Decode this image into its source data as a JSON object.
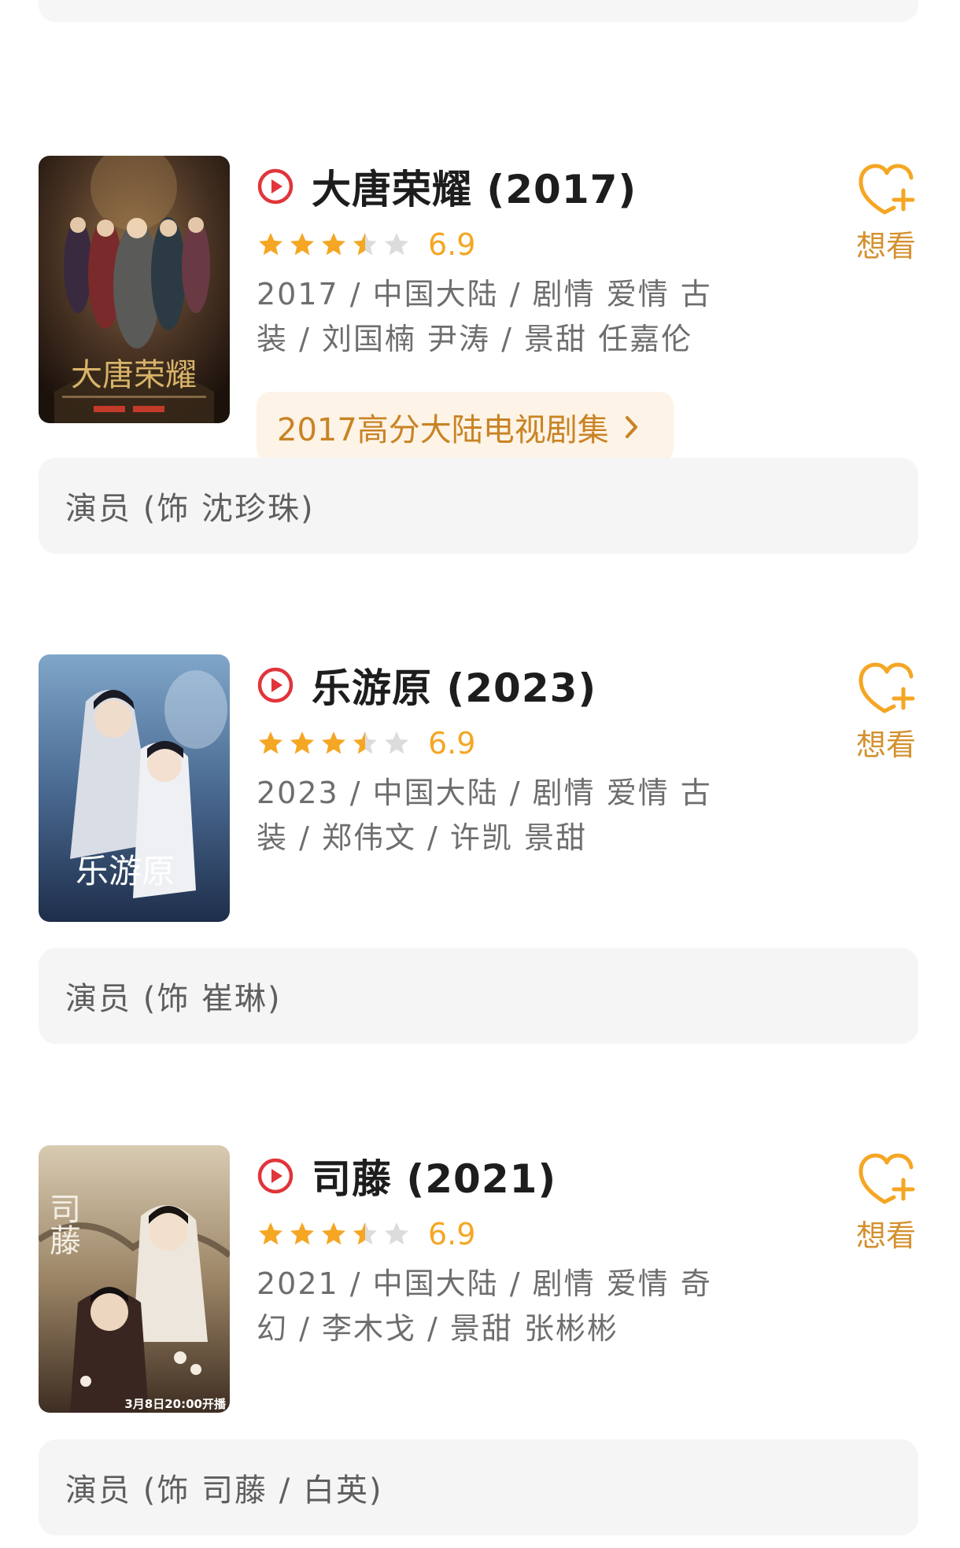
{
  "movies": [
    {
      "title": "大唐荣耀 (2017)",
      "score": "6.9",
      "stars": 3.5,
      "meta_line1": "2017 / 中国大陆 / 剧情 爱情 古",
      "meta_line2": "装 / 刘国楠 尹涛 / 景甜 任嘉伦",
      "collection": "2017高分大陆电视剧集",
      "want_label": "想看",
      "role": "演员 (饰 沈珍珠)",
      "poster_text": "大唐荣耀"
    },
    {
      "title": "乐游原 (2023)",
      "score": "6.9",
      "stars": 3.5,
      "meta_line1": "2023 / 中国大陆 / 剧情 爱情 古",
      "meta_line2": "装 / 郑伟文 / 许凯 景甜",
      "want_label": "想看",
      "role": "演员 (饰 崔琳)",
      "poster_text": "乐游原"
    },
    {
      "title": "司藤 (2021)",
      "score": "6.9",
      "stars": 3.5,
      "meta_line1": "2021 / 中国大陆 / 剧情 爱情 奇",
      "meta_line2": "幻 / 李木戈 / 景甜 张彬彬",
      "want_label": "想看",
      "role": "演员 (饰 司藤 / 白英)",
      "poster_text": "司藤",
      "poster_caption": "3月8日20:00开播"
    }
  ],
  "colors": {
    "accent_orange": "#f5a623",
    "play_red": "#e0353b",
    "want_orange": "#d4912f"
  }
}
